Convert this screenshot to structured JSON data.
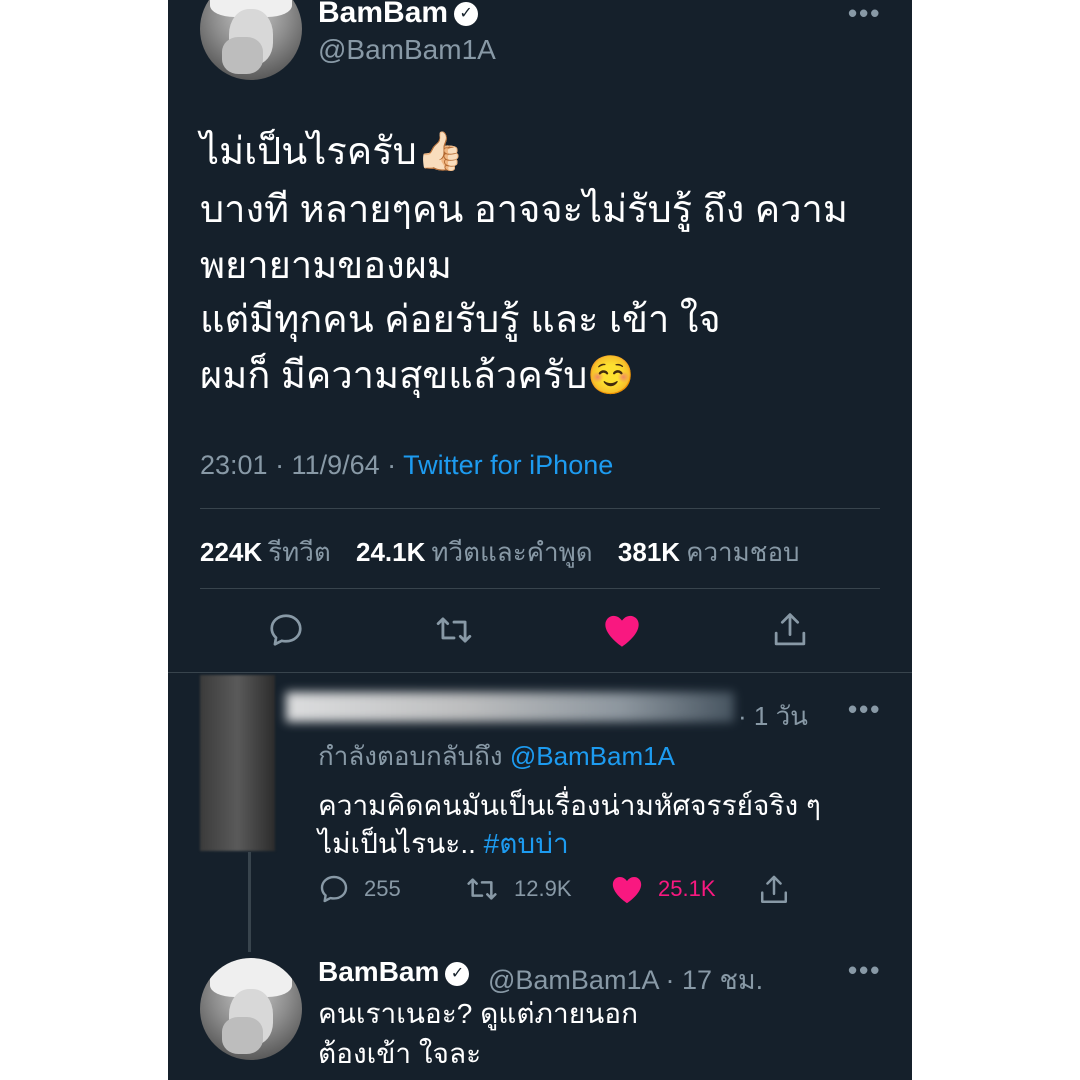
{
  "main_tweet": {
    "name": "BamBam",
    "handle": "@BamBam1A",
    "lines": [
      "ไม่เป็นไรครับ👍🏻",
      "บางที หลายๆคน อาจจะไม่รับรู้ ถึง ความ",
      "พยายามของผม",
      "แต่มีทุกคน ค่อยรับรู้ และ เข้า ใจ",
      "ผมก็ มีความสุขแล้วครับ☺️"
    ],
    "time": "23:01 · 11/9/64 · ",
    "source": "Twitter for iPhone",
    "stats": {
      "retweets": "224K",
      "retweets_label": "รีทวีต",
      "quotes": "24.1K",
      "quotes_label": "ทวีตและคำพูด",
      "likes": "381K",
      "likes_label": "ความชอบ"
    }
  },
  "reply": {
    "time": "· 1 วัน",
    "replying_prefix": "กำลังตอบกลับถึง ",
    "replying_handle": "@BamBam1A",
    "line1": "ความคิดคนมันเป็นเรื่องน่ามหัศจรรย์จริง ๆ",
    "line2": "ไม่เป็นไรนะ.. ",
    "hashtag": "#ตบบ่า",
    "replies": "255",
    "retweets": "12.9K",
    "likes": "25.1K"
  },
  "second_tweet": {
    "name": "BamBam",
    "handle": "@BamBam1A · 17 ชม.",
    "line1": "คนเราเนอะ? ดูแต่ภายนอก",
    "line2": "ต้องเข้า ใจละ"
  },
  "more_label": "•••",
  "verified_label": "✓",
  "colors": {
    "background": "#15202b",
    "accent": "#1d9bf0",
    "like": "#f91880",
    "muted": "#8899a6",
    "divider": "#38444d"
  },
  "icons": [
    "reply-icon",
    "retweet-icon",
    "heart-icon",
    "share-icon",
    "verified-icon",
    "more-icon"
  ]
}
